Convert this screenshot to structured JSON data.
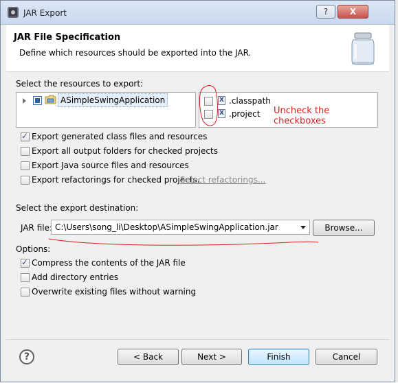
{
  "window": {
    "title": "JAR Export",
    "help_button": "?",
    "close_button": "X"
  },
  "header": {
    "title": "JAR File Specification",
    "description": "Define which resources should be exported into the JAR."
  },
  "resources": {
    "label": "Select the resources to export:",
    "project": "ASimpleSwingApplication",
    "files": [
      {
        "name": ".classpath",
        "checked": false
      },
      {
        "name": ".project",
        "checked": false
      }
    ]
  },
  "annotation": {
    "text": "Uncheck the checkboxes",
    "color": "#d81e1e"
  },
  "export_options": [
    {
      "label": "Export generated class files and resources",
      "checked": true
    },
    {
      "label": "Export all output folders for checked projects",
      "checked": false
    },
    {
      "label": "Export Java source files and resources",
      "checked": false
    },
    {
      "label": "Export refactorings for checked projects.",
      "checked": false
    }
  ],
  "select_refactorings_link": "Select refactorings...",
  "destination": {
    "label": "Select the export destination:",
    "jar_label": "JAR file:",
    "jar_path": "C:\\Users\\song_li\\Desktop\\ASimpleSwingApplication.jar",
    "browse": "Browse..."
  },
  "options": {
    "label": "Options:",
    "items": [
      {
        "label": "Compress the contents of the JAR file",
        "checked": true
      },
      {
        "label": "Add directory entries",
        "checked": false
      },
      {
        "label": "Overwrite existing files without warning",
        "checked": false
      }
    ]
  },
  "buttons": {
    "help": "?",
    "back": "< Back",
    "next": "Next >",
    "finish": "Finish",
    "cancel": "Cancel"
  }
}
